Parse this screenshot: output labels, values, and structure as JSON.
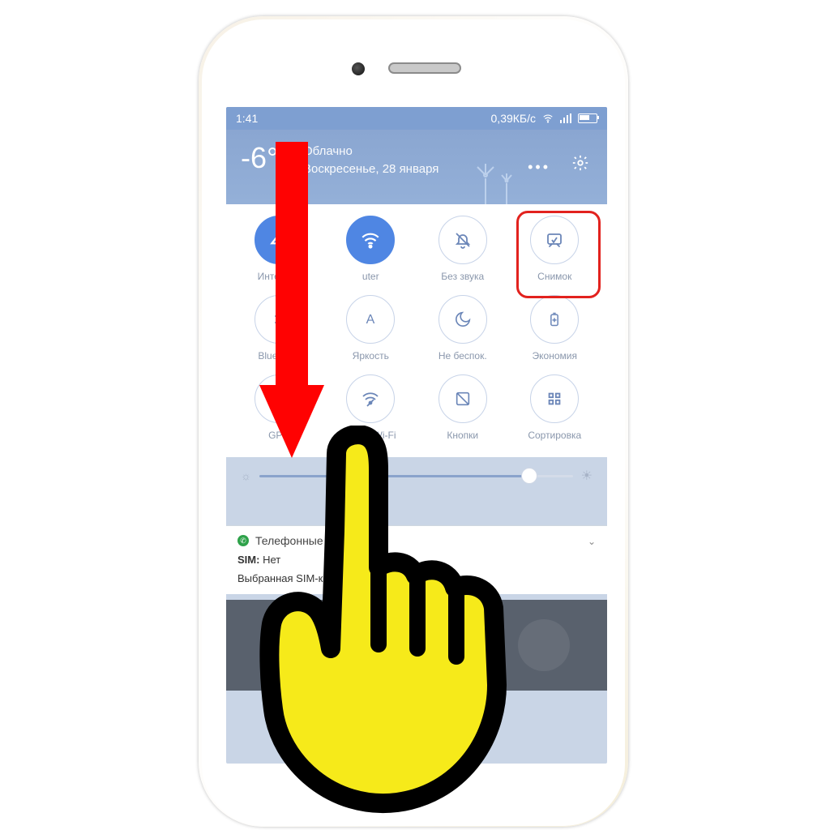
{
  "statusbar": {
    "time": "1:41",
    "net_speed": "0,39КБ/с"
  },
  "weather": {
    "temperature": "-6°",
    "condition": "Облачно",
    "date": "Воскресенье, 28 января"
  },
  "quick_settings": {
    "tiles": [
      {
        "label": "Интернет",
        "icon": "globe-icon",
        "active": true
      },
      {
        "label": "uter",
        "icon": "wifi-icon",
        "active": true
      },
      {
        "label": "Без звука",
        "icon": "bell-off-icon",
        "active": false
      },
      {
        "label": "Снимок",
        "icon": "screenshot-icon",
        "active": false
      },
      {
        "label": "Bluetooth",
        "icon": "bluetooth-icon",
        "active": false
      },
      {
        "label": "Яркость",
        "icon": "brightness-icon",
        "active": false
      },
      {
        "label": "Не беспок.",
        "icon": "moon-icon",
        "active": false
      },
      {
        "label": "Экономия",
        "icon": "battery-icon",
        "active": false
      },
      {
        "label": "GPS",
        "icon": "location-icon",
        "active": false
      },
      {
        "label": "Точка Wi-Fi",
        "icon": "hotspot-icon",
        "active": false
      },
      {
        "label": "Кнопки",
        "icon": "buttons-icon",
        "active": false
      },
      {
        "label": "Сортировка",
        "icon": "reorder-icon",
        "active": false
      }
    ]
  },
  "slider": {
    "brightness_pct": 86
  },
  "notification": {
    "app": "Телефонные сервисы",
    "line1_prefix": "SIM:",
    "line1_value": "Нет",
    "line2": "Выбранная SIM-карта для передачи данных..."
  },
  "overlay": {
    "arrow_color": "#ff0202",
    "hand_fill": "#f6ea1a",
    "hand_stroke": "#000000",
    "highlight_target_index": 3
  }
}
